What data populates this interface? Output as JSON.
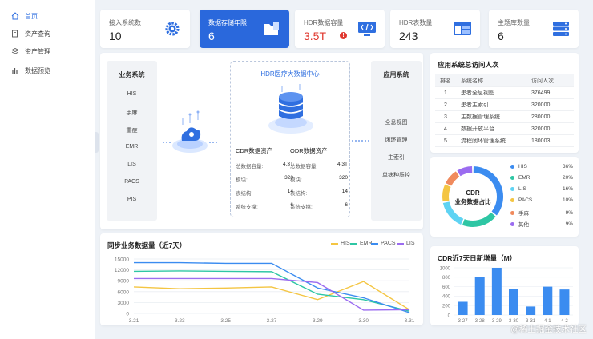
{
  "sidebar": {
    "items": [
      {
        "label": "首页",
        "icon": "home-icon",
        "active": true
      },
      {
        "label": "资产查询",
        "icon": "search-doc-icon",
        "active": false
      },
      {
        "label": "资产管理",
        "icon": "layers-icon",
        "active": false
      },
      {
        "label": "数据预览",
        "icon": "bar-icon",
        "active": false
      }
    ]
  },
  "stats": [
    {
      "label": "接入系统数",
      "value": "10",
      "icon": "gear-icon"
    },
    {
      "label": "数据存储年限",
      "value": "6",
      "icon": "folder-icon"
    },
    {
      "label": "HDR数据容量",
      "value": "3.5T",
      "icon": "code-monitor-icon",
      "alert": "!"
    },
    {
      "label": "HDR表数量",
      "value": "243",
      "icon": "window-icon"
    },
    {
      "label": "主题库数量",
      "value": "6",
      "icon": "server-icon"
    }
  ],
  "center": {
    "business": {
      "title": "业务系统",
      "items": [
        "HIS",
        "手麻",
        "重症",
        "EMR",
        "LIS",
        "PACS",
        "PIS"
      ]
    },
    "hub": {
      "title": "HDR医疗大数据中心"
    },
    "assets": [
      {
        "title": "CDR数据资产",
        "rows": [
          [
            "总数据容量:",
            "4.3T"
          ],
          [
            "模块:",
            "320"
          ],
          [
            "表结构:",
            "14"
          ],
          [
            "系统支撑:",
            "6"
          ]
        ]
      },
      {
        "title": "ODR数据资产",
        "rows": [
          [
            "总数据容量:",
            "4.3T"
          ],
          [
            "模块:",
            "320"
          ],
          [
            "表结构:",
            "14"
          ],
          [
            "系统支撑:",
            "6"
          ]
        ]
      }
    ],
    "apps": {
      "title": "应用系统",
      "items": [
        "全息视图",
        "闭环管理",
        "主索引",
        "单病种质控"
      ]
    }
  },
  "visits": {
    "title": "应用系统总访问人次",
    "columns": [
      "排名",
      "系统名称",
      "访问人次"
    ],
    "rows": [
      [
        "1",
        "患者全息视图",
        "376499"
      ],
      [
        "2",
        "患者主索引",
        "320000"
      ],
      [
        "3",
        "主数据管理系统",
        "280000"
      ],
      [
        "4",
        "数据开放平台",
        "320000"
      ],
      [
        "5",
        "流程闭环管理系统",
        "180003"
      ]
    ]
  },
  "share": {
    "center_label_1": "CDR",
    "center_label_2": "业务数据占比",
    "items": [
      {
        "name": "HIS",
        "pct": "36%",
        "value": 36,
        "color": "#3b8cf0"
      },
      {
        "name": "EMR",
        "pct": "20%",
        "value": 20,
        "color": "#2ec6a4"
      },
      {
        "name": "LIS",
        "pct": "16%",
        "value": 16,
        "color": "#5fd3f3"
      },
      {
        "name": "PACS",
        "pct": "10%",
        "value": 10,
        "color": "#f4c542"
      },
      {
        "name": "手麻",
        "pct": "9%",
        "value": 9,
        "color": "#f08a5d"
      },
      {
        "name": "其他",
        "pct": "9%",
        "value": 9,
        "color": "#9b6cf0"
      }
    ]
  },
  "sync": {
    "title": "同步业务数据量（近7天）",
    "legend": [
      "HIS",
      "EMR",
      "PACS",
      "LIS"
    ]
  },
  "daily": {
    "title": "CDR近7天日新增量（M）"
  },
  "watermark": "@稀土掘金技术社区",
  "chart_data": [
    {
      "type": "line",
      "title": "同步业务数据量（近7天）",
      "x": [
        "3.21",
        "3.23",
        "3.25",
        "3.27",
        "3.29",
        "3.30",
        "3.31"
      ],
      "yticks": [
        "15000",
        "12000",
        "9000",
        "6000",
        "3000",
        "0"
      ],
      "ylim": [
        0,
        15000
      ],
      "series": [
        {
          "name": "HIS",
          "color": "#f4c542",
          "values": [
            7300,
            6800,
            7000,
            7300,
            3800,
            8800,
            1000
          ]
        },
        {
          "name": "EMR",
          "color": "#2ec6a4",
          "values": [
            11600,
            11700,
            11600,
            11500,
            5300,
            3800,
            600
          ]
        },
        {
          "name": "PACS",
          "color": "#3b8cf0",
          "values": [
            14000,
            14000,
            13800,
            13800,
            7000,
            4300,
            200
          ]
        },
        {
          "name": "LIS",
          "color": "#9b6cf0",
          "values": [
            9600,
            9600,
            9600,
            9600,
            8500,
            900,
            1000
          ]
        }
      ]
    },
    {
      "type": "bar",
      "title": "CDR近7天日新增量（M）",
      "categories": [
        "3-27",
        "3-28",
        "3-29",
        "3-30",
        "3-31",
        "4-1",
        "4-2"
      ],
      "values": [
        280,
        800,
        1000,
        550,
        180,
        600,
        540
      ],
      "yticks": [
        "1000",
        "800",
        "600",
        "400",
        "200",
        "0"
      ],
      "ylim": [
        0,
        1000
      ],
      "color": "#3b8cf0"
    }
  ]
}
